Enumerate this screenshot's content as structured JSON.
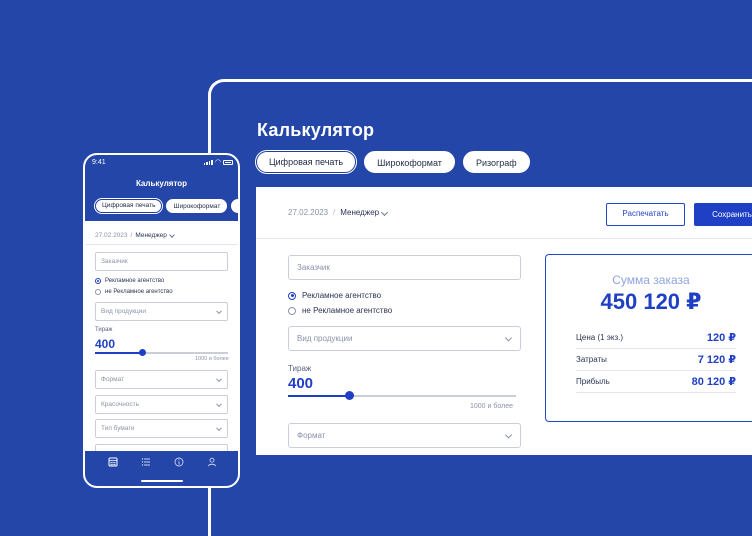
{
  "desktop": {
    "title": "Калькулятор",
    "tabs": [
      {
        "label": "Цифровая печать",
        "active": true
      },
      {
        "label": "Широкоформат",
        "active": false
      },
      {
        "label": "Ризограф",
        "active": false
      }
    ],
    "toolbar": {
      "date": "27.02.2023",
      "separator": "/",
      "manager": "Менеджер",
      "print_label": "Распечатать",
      "save_label": "Сохранить"
    },
    "form": {
      "customer_placeholder": "Заказчик",
      "radio_agency": "Рекламное агентство",
      "radio_not_agency": "не Рекламное агентство",
      "product_placeholder": "Вид продукции",
      "circulation_label": "Тираж",
      "circulation_value": "400",
      "circulation_fraction": 0.27,
      "circulation_max": "1000 и более",
      "format_placeholder": "Формат"
    },
    "summary": {
      "title": "Сумма заказа",
      "total": "450 120 ₽",
      "rows": [
        {
          "label": "Цена (1 экз.)",
          "value": "120 ₽"
        },
        {
          "label": "Затраты",
          "value": "7 120 ₽"
        },
        {
          "label": "Прибыль",
          "value": "80 120 ₽"
        }
      ]
    }
  },
  "mobile": {
    "status_time": "9:41",
    "title": "Калькулятор",
    "tabs": [
      {
        "label": "Цифровая печать",
        "active": true
      },
      {
        "label": "Широкоформат",
        "active": false
      },
      {
        "label": "Р",
        "active": false
      }
    ],
    "date": "27.02.2023",
    "separator": "/",
    "manager": "Менеджер",
    "customer_placeholder": "Заказчик",
    "radio_agency": "Рекламное агентство",
    "radio_not_agency": "не Рекламное агентство",
    "product_placeholder": "Вид продукции",
    "circulation_label": "Тираж",
    "circulation_value": "400",
    "circulation_fraction": 0.36,
    "circulation_max": "1000 и более",
    "format_placeholder": "Формат",
    "color_placeholder": "Красочность",
    "paper_placeholder": "Тип бумаги",
    "nav_icons": [
      "calculator-icon",
      "list-icon",
      "info-icon",
      "profile-icon"
    ]
  },
  "colors": {
    "background": "#2446a8",
    "accent": "#1f3fc4",
    "summary_title": "#8fa4e4"
  }
}
